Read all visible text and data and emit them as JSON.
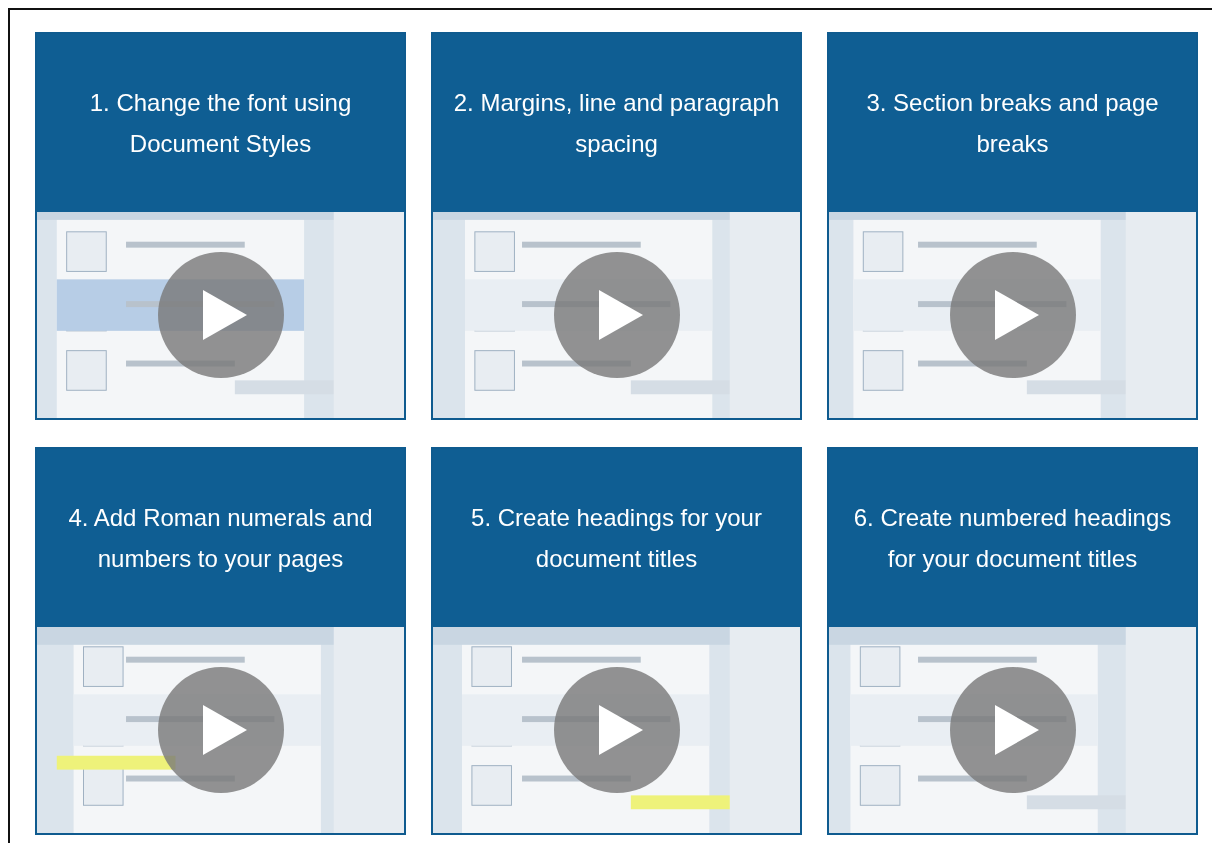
{
  "cards": [
    {
      "title": "1. Change the font using Document Styles"
    },
    {
      "title": "2. Margins, line and paragraph spacing"
    },
    {
      "title": "3. Section breaks and page breaks"
    },
    {
      "title": "4. Add Roman numerals and numbers to your pages"
    },
    {
      "title": "5. Create headings for your document titles"
    },
    {
      "title": "6. Create numbered headings for your document titles"
    }
  ]
}
